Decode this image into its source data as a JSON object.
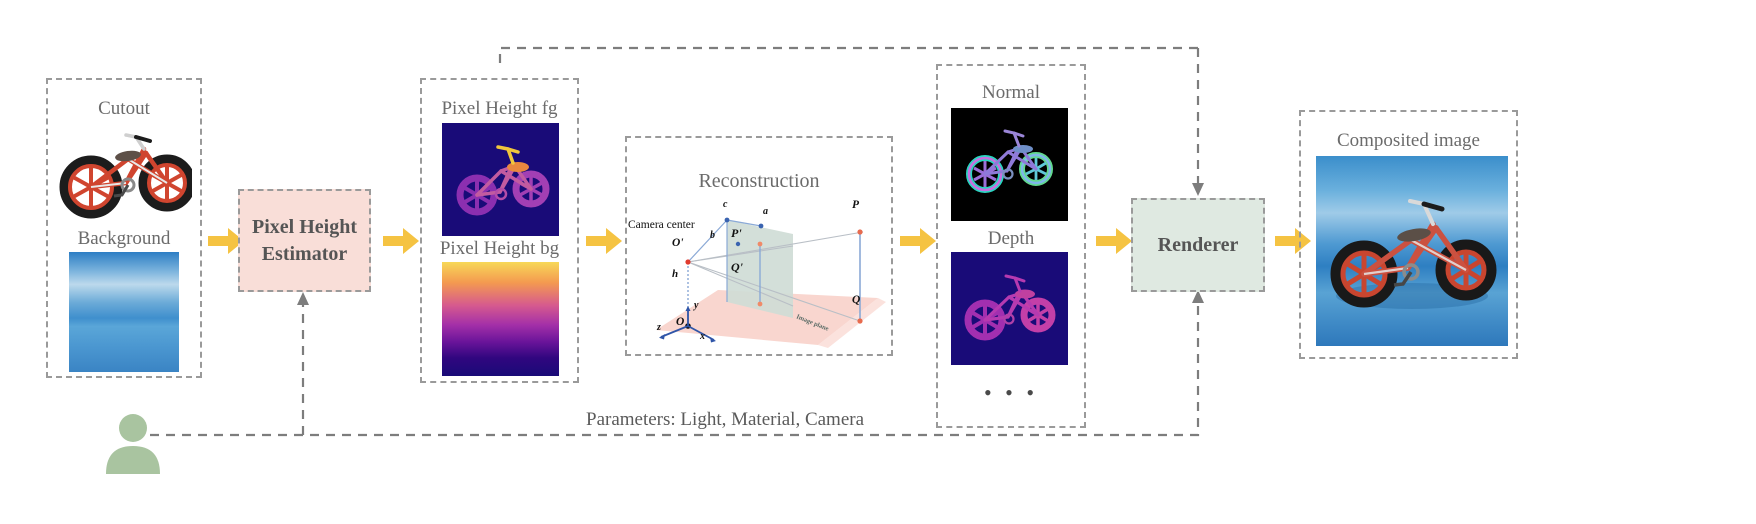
{
  "figure": {
    "type": "pipeline-diagram",
    "title": "Pixel Height Estimator to Renderer compositing pipeline"
  },
  "inputs": {
    "cutout_label": "Cutout",
    "background_label": "Background"
  },
  "estimator": {
    "label_line1": "Pixel Height",
    "label_line2": "Estimator"
  },
  "pixel_height": {
    "fg_label": "Pixel Height fg",
    "bg_label": "Pixel Height bg"
  },
  "reconstruction": {
    "title": "Reconstruction",
    "camera_center_label": "Camera  center",
    "image_plane_label": "Image plane",
    "points": {
      "o_prime": "O'",
      "o": "O",
      "p_prime": "P'",
      "q_prime": "Q'",
      "p": "P",
      "q": "Q",
      "a": "a",
      "b": "b",
      "c": "c",
      "h": "h",
      "x": "x",
      "y": "y",
      "z": "z"
    }
  },
  "buffers": {
    "normal_label": "Normal",
    "depth_label": "Depth",
    "more_label": "•  •  •"
  },
  "renderer": {
    "label": "Renderer"
  },
  "output": {
    "composited_label": "Composited image"
  },
  "feedback": {
    "parameters_label": "Parameters: Light, Material, Camera"
  },
  "user": {
    "icon": "user-avatar-icon"
  },
  "colors": {
    "dashed_border": "#9a9a9a",
    "estimator_fill": "#f9ded8",
    "renderer_fill": "#dfe9e1",
    "arrow_yellow": "#f5c342",
    "title_text": "#6b6b6b",
    "depth_bg": "#170b7a",
    "ground_plane": "#f9d6cf",
    "image_plane": "#cfdcd6",
    "user_green": "#a9c4a0"
  }
}
